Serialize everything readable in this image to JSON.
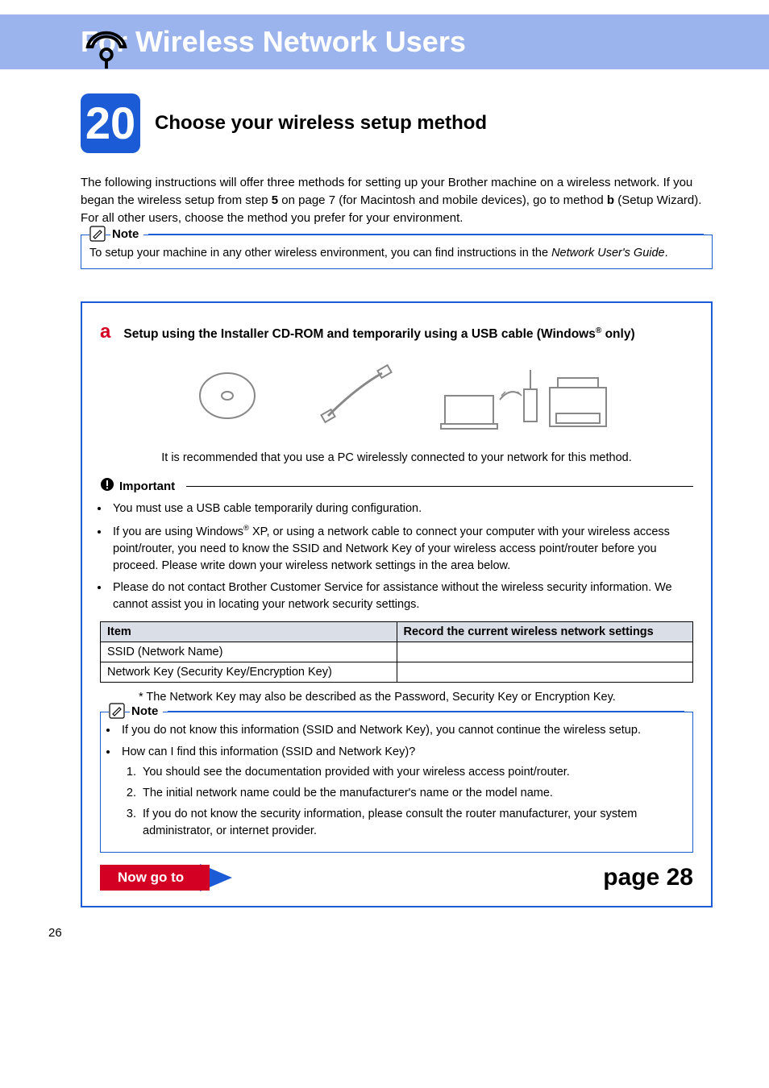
{
  "header": {
    "title": "For Wireless Network Users"
  },
  "step": {
    "number": "20",
    "title": "Choose your wireless setup method"
  },
  "intro": {
    "p1_a": "The following instructions will offer three methods for setting up your Brother machine on a wireless network. If you began the wireless setup from step ",
    "p1_b": "5",
    "p1_c": " on page 7 (for Macintosh and mobile devices), go to method ",
    "p1_d": "b",
    "p1_e": " (Setup Wizard). For all other users, choose the method you prefer for your environment."
  },
  "note1": {
    "label": "Note",
    "text_a": "To setup your machine in any other wireless environment, you can find instructions in the ",
    "text_em": "Network User's Guide",
    "text_b": "."
  },
  "method_a": {
    "letter": "a",
    "title_a": "Setup using the Installer CD-ROM and temporarily using a USB cable (Windows",
    "title_b": " only)",
    "recommend": "It is recommended that you use a PC wirelessly connected to your network for this method.",
    "important_label": "Important",
    "bullets": {
      "b1": "You must use a USB cable temporarily during configuration.",
      "b2_a": "If you are using Windows",
      "b2_b": " XP, or using a network cable to connect your computer with your wireless access point/router, you need to know the SSID and Network Key of your wireless access point/router before you proceed. Please write down your wireless network settings in the area below.",
      "b3": "Please do not contact Brother Customer Service for assistance without the wireless security information. We cannot assist you in locating your network security settings."
    },
    "table": {
      "h1": "Item",
      "h2": "Record the current wireless network settings",
      "r1": "SSID (Network Name)",
      "r2": "Network Key (Security Key/Encryption Key)"
    },
    "footnote": "*  The Network Key may also be described as the Password, Security Key or Encryption Key."
  },
  "note2": {
    "label": "Note",
    "b1": "If you do not know this information (SSID and Network Key), you cannot continue the wireless setup.",
    "b2": "How can I find this information (SSID and Network Key)?",
    "n1": "You should see the documentation provided with your wireless access point/router.",
    "n2": "The initial network name could be the manufacturer's name or the model name.",
    "n3": "If you do not know the security information, please consult the router manufacturer, your system administrator, or internet provider."
  },
  "goto": {
    "label": "Now go to",
    "target": "page 28"
  },
  "page_number": "26"
}
